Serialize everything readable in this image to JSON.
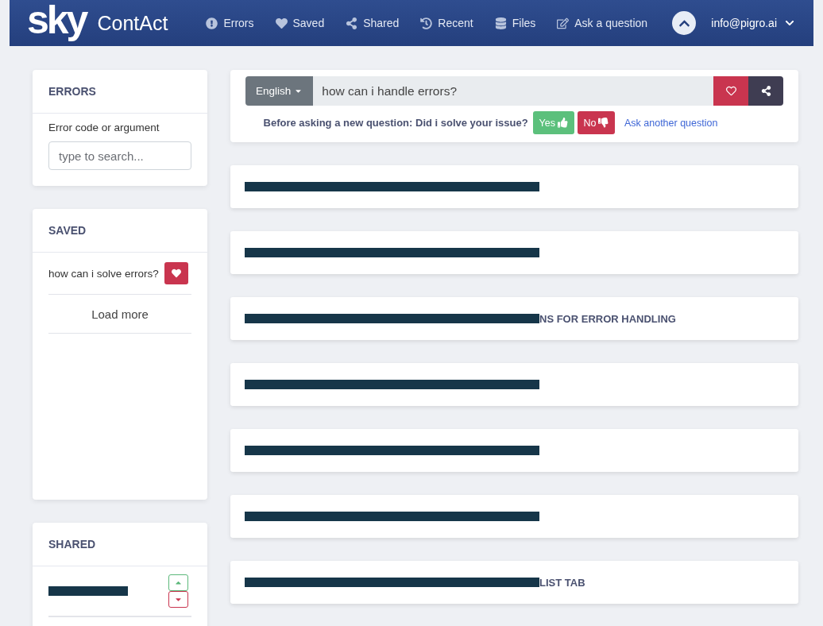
{
  "navbar": {
    "logo": "sky",
    "app_name": "ContAct",
    "items": [
      {
        "kind": "errors",
        "label": "Errors"
      },
      {
        "kind": "saved",
        "label": "Saved"
      },
      {
        "kind": "shared",
        "label": "Shared"
      },
      {
        "kind": "recent",
        "label": "Recent"
      },
      {
        "kind": "files",
        "label": "Files"
      },
      {
        "kind": "ask",
        "label": "Ask a question"
      }
    ],
    "user": "info@pigro.ai"
  },
  "errors_panel": {
    "title": "ERRORS",
    "label": "Error code or argument",
    "placeholder": "type to search..."
  },
  "saved_panel": {
    "title": "SAVED",
    "items": [
      {
        "text": "how can i solve errors?"
      }
    ],
    "load_more": "Load more"
  },
  "shared_panel": {
    "title": "SHARED",
    "items": [
      {
        "redacted": true
      }
    ]
  },
  "search": {
    "language": "English",
    "value": "how can i handle errors?"
  },
  "feedback": {
    "prompt": "Before asking a new question: Did i solve your issue?",
    "yes": "Yes",
    "no": "No",
    "link": "Ask another question"
  },
  "results": [
    {
      "redacted": true
    },
    {
      "redacted": true
    },
    {
      "redacted": true,
      "text": "NS FOR ERROR HANDLING"
    },
    {
      "redacted": true
    },
    {
      "redacted": true
    },
    {
      "redacted": true
    },
    {
      "redacted": true,
      "text": "LIST TAB"
    }
  ]
}
